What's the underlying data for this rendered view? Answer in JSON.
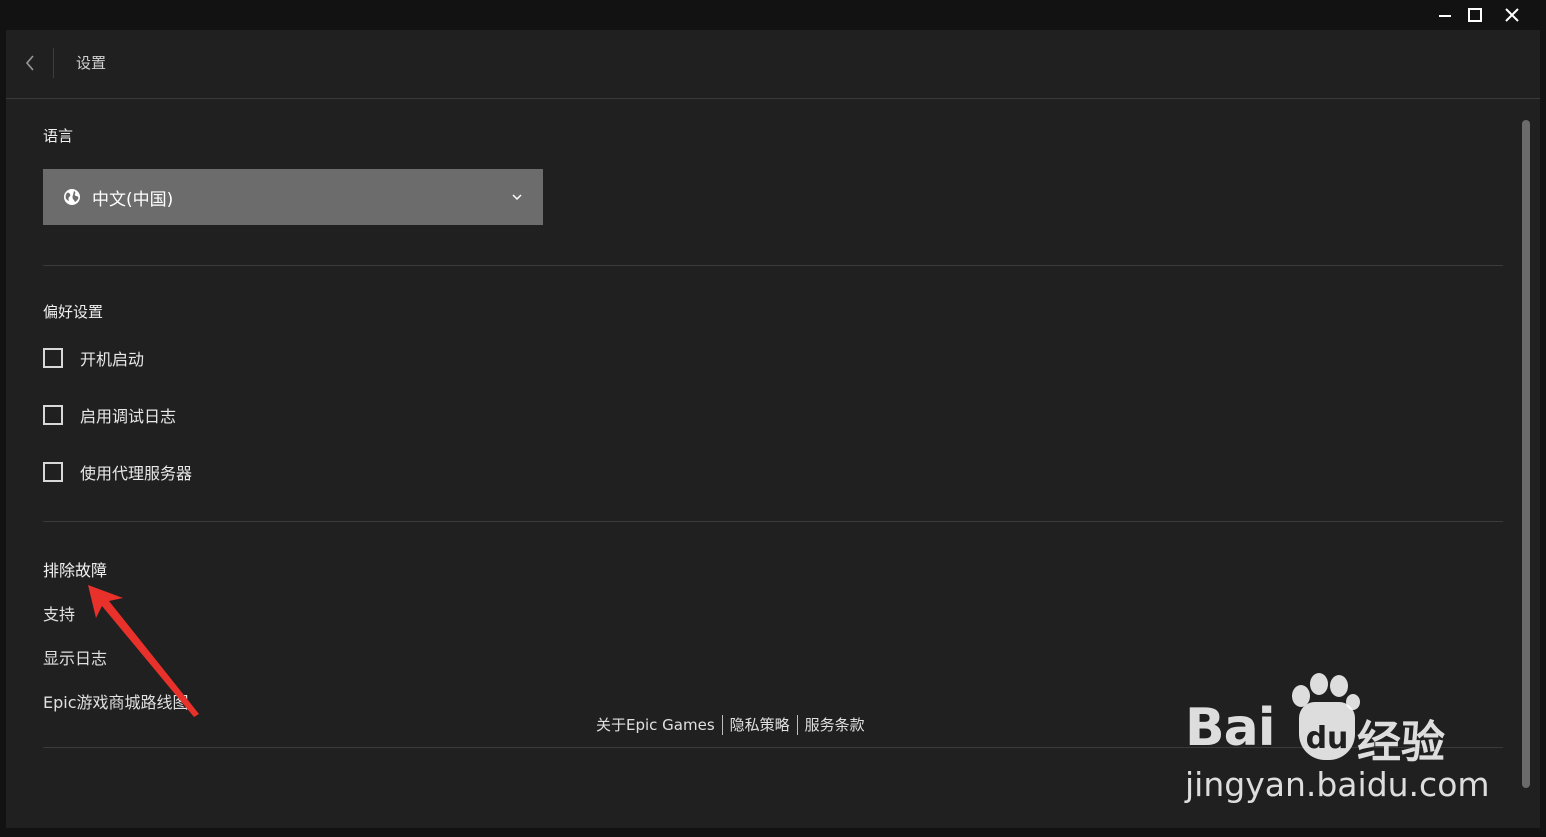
{
  "header": {
    "title": "设置"
  },
  "language": {
    "label": "语言",
    "selected": "中文(中国)"
  },
  "preferences": {
    "label": "偏好设置",
    "items": [
      {
        "label": "开机启动",
        "checked": false
      },
      {
        "label": "启用调试日志",
        "checked": false
      },
      {
        "label": "使用代理服务器",
        "checked": false
      }
    ]
  },
  "troubleshoot": {
    "label": "排除故障",
    "links": [
      "支持",
      "显示日志",
      "Epic游戏商城路线图"
    ]
  },
  "footer": {
    "about": "关于Epic Games",
    "privacy": "隐私策略",
    "terms": "服务条款"
  },
  "watermark": {
    "bai": "Bai",
    "du": "du",
    "jingyan": "经验",
    "url": "jingyan.baidu.com"
  },
  "annotation_color": "#e8312a"
}
